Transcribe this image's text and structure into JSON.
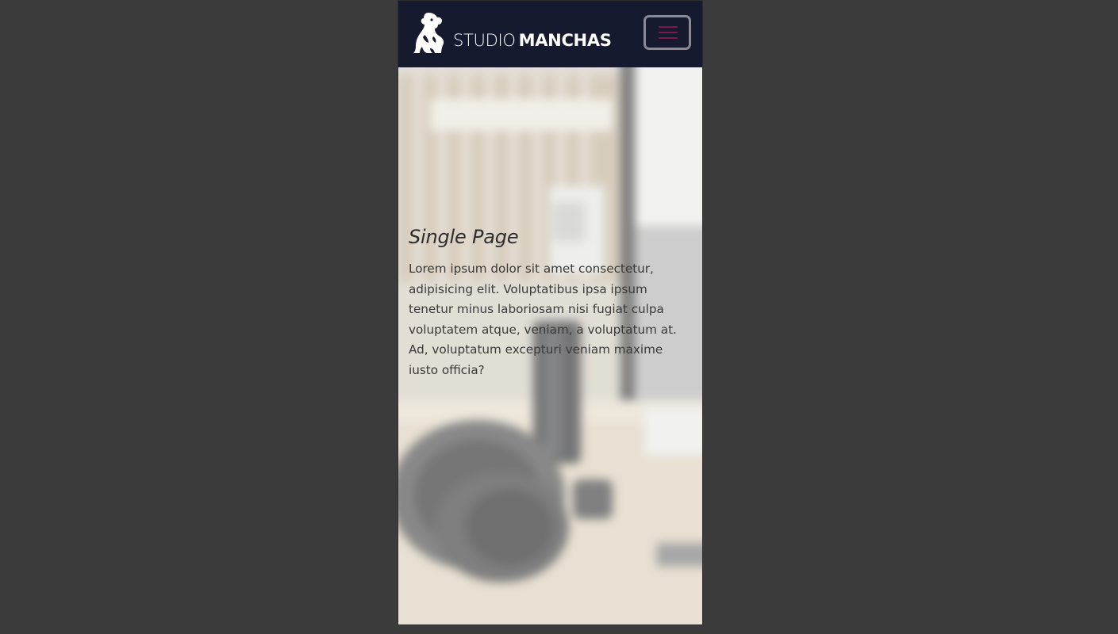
{
  "brand": {
    "prefix": "STUDIO",
    "name": "MANCHAS",
    "logo_icon": "dog-logo-icon"
  },
  "navbar": {
    "menu_icon": "hamburger-menu-icon",
    "background_color": "#161a2f",
    "menu_bar_color": "#7a1a4a"
  },
  "hero": {
    "title": "Single Page",
    "body": "Lorem ipsum dolor sit amet consectetur, adipisicing elit. Voluptatibus ipsa ipsum tenetur minus laboriosam nisi fugiat culpa voluptatem atque, veniam, a voluptatum at. Ad, voluptatum excepturi veniam maxime iusto officia?",
    "background": "blurred-desk-photo"
  }
}
